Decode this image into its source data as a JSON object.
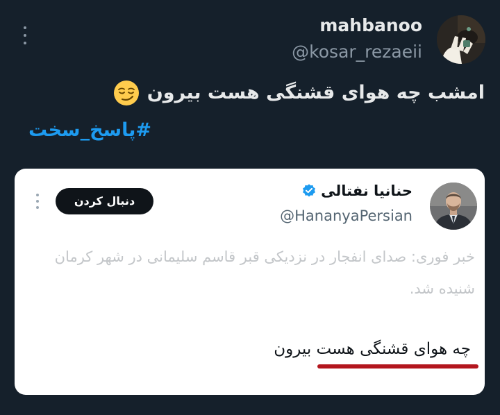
{
  "tweet": {
    "author_name": "mahbanoo",
    "author_handle": "@kosar_rezaeii",
    "text": "امشب چه هوای قشنگی هست بیرون",
    "emoji": "smirking-face",
    "hashtag": "#پاسخ_سخت"
  },
  "quoted_card": {
    "author_name": "حنانیا نفتالی",
    "author_handle": "@HananyaPersian",
    "verified": true,
    "follow_label": "دنبال کردن",
    "faded_text": "خبر فوری: صدای انفجار در نزدیکی قبر قاسم سلیمانی در شهر کرمان شنیده شد.",
    "highlighted_text": "چه هوای قشنگی هست بیرون"
  },
  "colors": {
    "background": "#15202b",
    "primary_text": "#e7e9ea",
    "secondary_text": "#8b98a5",
    "hashtag": "#1d9bf0",
    "card_background": "#ffffff",
    "verified_badge": "#1d9bf0",
    "underline": "#b3161e"
  }
}
